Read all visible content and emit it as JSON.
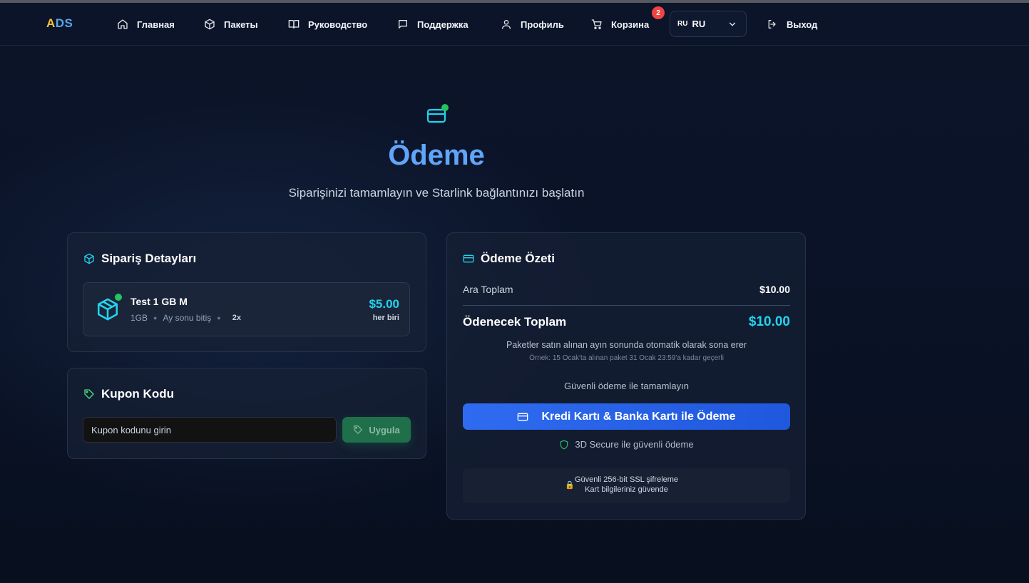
{
  "nav": {
    "logo_a": "A",
    "logo_ds": "DS",
    "items": [
      {
        "label": "Главная",
        "icon": "home-icon"
      },
      {
        "label": "Пакеты",
        "icon": "package-icon"
      },
      {
        "label": "Руководство",
        "icon": "book-icon"
      },
      {
        "label": "Поддержка",
        "icon": "message-icon"
      },
      {
        "label": "Профиль",
        "icon": "user-icon"
      },
      {
        "label": "Корзина",
        "icon": "cart-icon"
      }
    ],
    "cart_count": "2",
    "language": {
      "flag": "RU",
      "code": "RU"
    },
    "logout": "Выход"
  },
  "hero": {
    "title": "Ödeme",
    "subtitle": "Siparişinizi tamamlayın ve Starlink bağlantınızı başlatın"
  },
  "order": {
    "title": "Sipariş Detayları",
    "item": {
      "name": "Test 1 GB M",
      "size": "1GB",
      "expiry": "Ay sonu bitiş",
      "quantity": "2x",
      "price": "$5.00",
      "per": "her biri"
    }
  },
  "coupon": {
    "title": "Kupon Kodu",
    "placeholder": "Kupon kodunu girin",
    "apply": "Uygula"
  },
  "summary": {
    "title": "Ödeme Özeti",
    "subtotal_label": "Ara Toplam",
    "subtotal_value": "$10.00",
    "total_label": "Ödenecek Toplam",
    "total_value": "$10.00",
    "note": "Paketler satın alınan ayın sonunda otomatik olarak sona erer",
    "example": "Örnek: 15 Ocak'ta alınan paket 31 Ocak 23:59'a kadar geçerli",
    "secure_prompt": "Güvenli ödeme ile tamamlayın",
    "pay_button": "Kredi Kartı & Banka Kartı ile Ödeme",
    "three_d": "3D Secure ile güvenli ödeme",
    "ssl_line1": "Güvenli 256-bit SSL şifreleme",
    "ssl_line2": "Kart bilgileriniz güvende"
  },
  "colors": {
    "background": "#0a1226",
    "accent_blue": "#60a5fa",
    "accent_cyan": "#22d3ee",
    "button_blue": "#2563eb",
    "apply_green": "#1f6f4a",
    "status_green": "#22c55e",
    "badge_red": "#ef4444",
    "logo_yellow": "#f2c230"
  }
}
